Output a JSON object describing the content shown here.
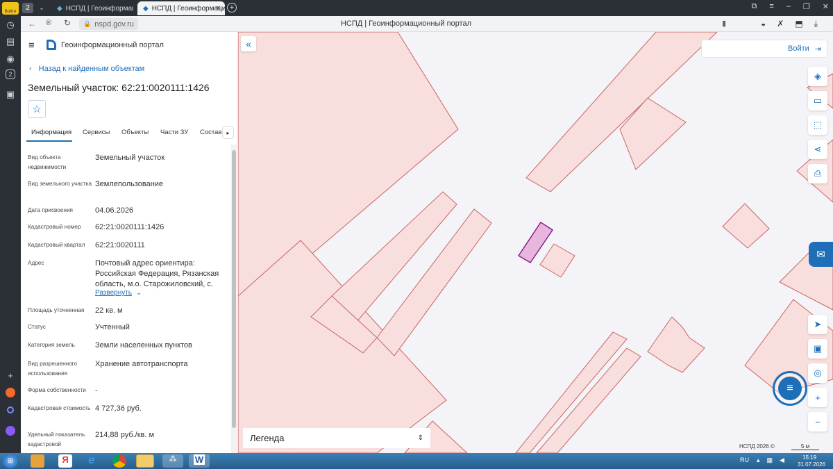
{
  "browser": {
    "login_badge": "Войти",
    "tab_count": "2",
    "tabs": [
      {
        "title": "НСПД | Геоинформаци"
      },
      {
        "title": "НСПД | Геоинформацио"
      }
    ],
    "url": "nspd.gov.ru",
    "page_title": "НСПД | Геоинформационный портал",
    "sidebar_badge": "2"
  },
  "app": {
    "title": "Геоинформационный портал",
    "back_link": "Назад к найденным объектам",
    "object_title": "Земельный участок: 62:21:0020111:1426",
    "tabs": [
      "Информация",
      "Сервисы",
      "Объекты",
      "Части ЗУ",
      "Состав"
    ],
    "fields": [
      {
        "label": "Вид объекта недвижимости",
        "value": "Земельный участок"
      },
      {
        "label": "Вид земельного участка",
        "value": "Землепользование"
      },
      {
        "label": "Дата присвоения",
        "value": "04.06.2026"
      },
      {
        "label": "Кадастровый номер",
        "value": "62:21:0020111:1426"
      },
      {
        "label": "Кадастровый квартал",
        "value": "62:21:0020111"
      },
      {
        "label": "Адрес",
        "value": "Почтовый адрес ориентира: Российская Федерация, Рязанская область, м.о. Старожиловский, с."
      },
      {
        "label": "Площадь уточненная",
        "value": "22 кв. м"
      },
      {
        "label": "Статус",
        "value": "Учтенный"
      },
      {
        "label": "Категория земель",
        "value": "Земли населенных пунктов"
      },
      {
        "label": "Вид разрешенного использования",
        "value": "Хранение автотранспорта"
      },
      {
        "label": "Форма собственности",
        "value": "-"
      },
      {
        "label": "Кадастровая стоимость",
        "value": "4 727,36 руб."
      },
      {
        "label": "Удельный показатель кадастровой",
        "value": "214,88 руб./кв. м"
      }
    ],
    "expand_label": "Развернуть"
  },
  "map": {
    "login_label": "Войти",
    "legend_label": "Легенда",
    "copyright": "НСПД 2026 ©",
    "scale": "5 м"
  },
  "taskbar": {
    "lang": "RU",
    "time": "15:19",
    "date": "31.07.2026"
  },
  "colors": {
    "accent": "#1e6fb8",
    "parcel_fill": "#f8dedd",
    "parcel_stroke": "#c96565",
    "selected_fill": "#e8b6dc",
    "selected_stroke": "#8a1f8c"
  }
}
